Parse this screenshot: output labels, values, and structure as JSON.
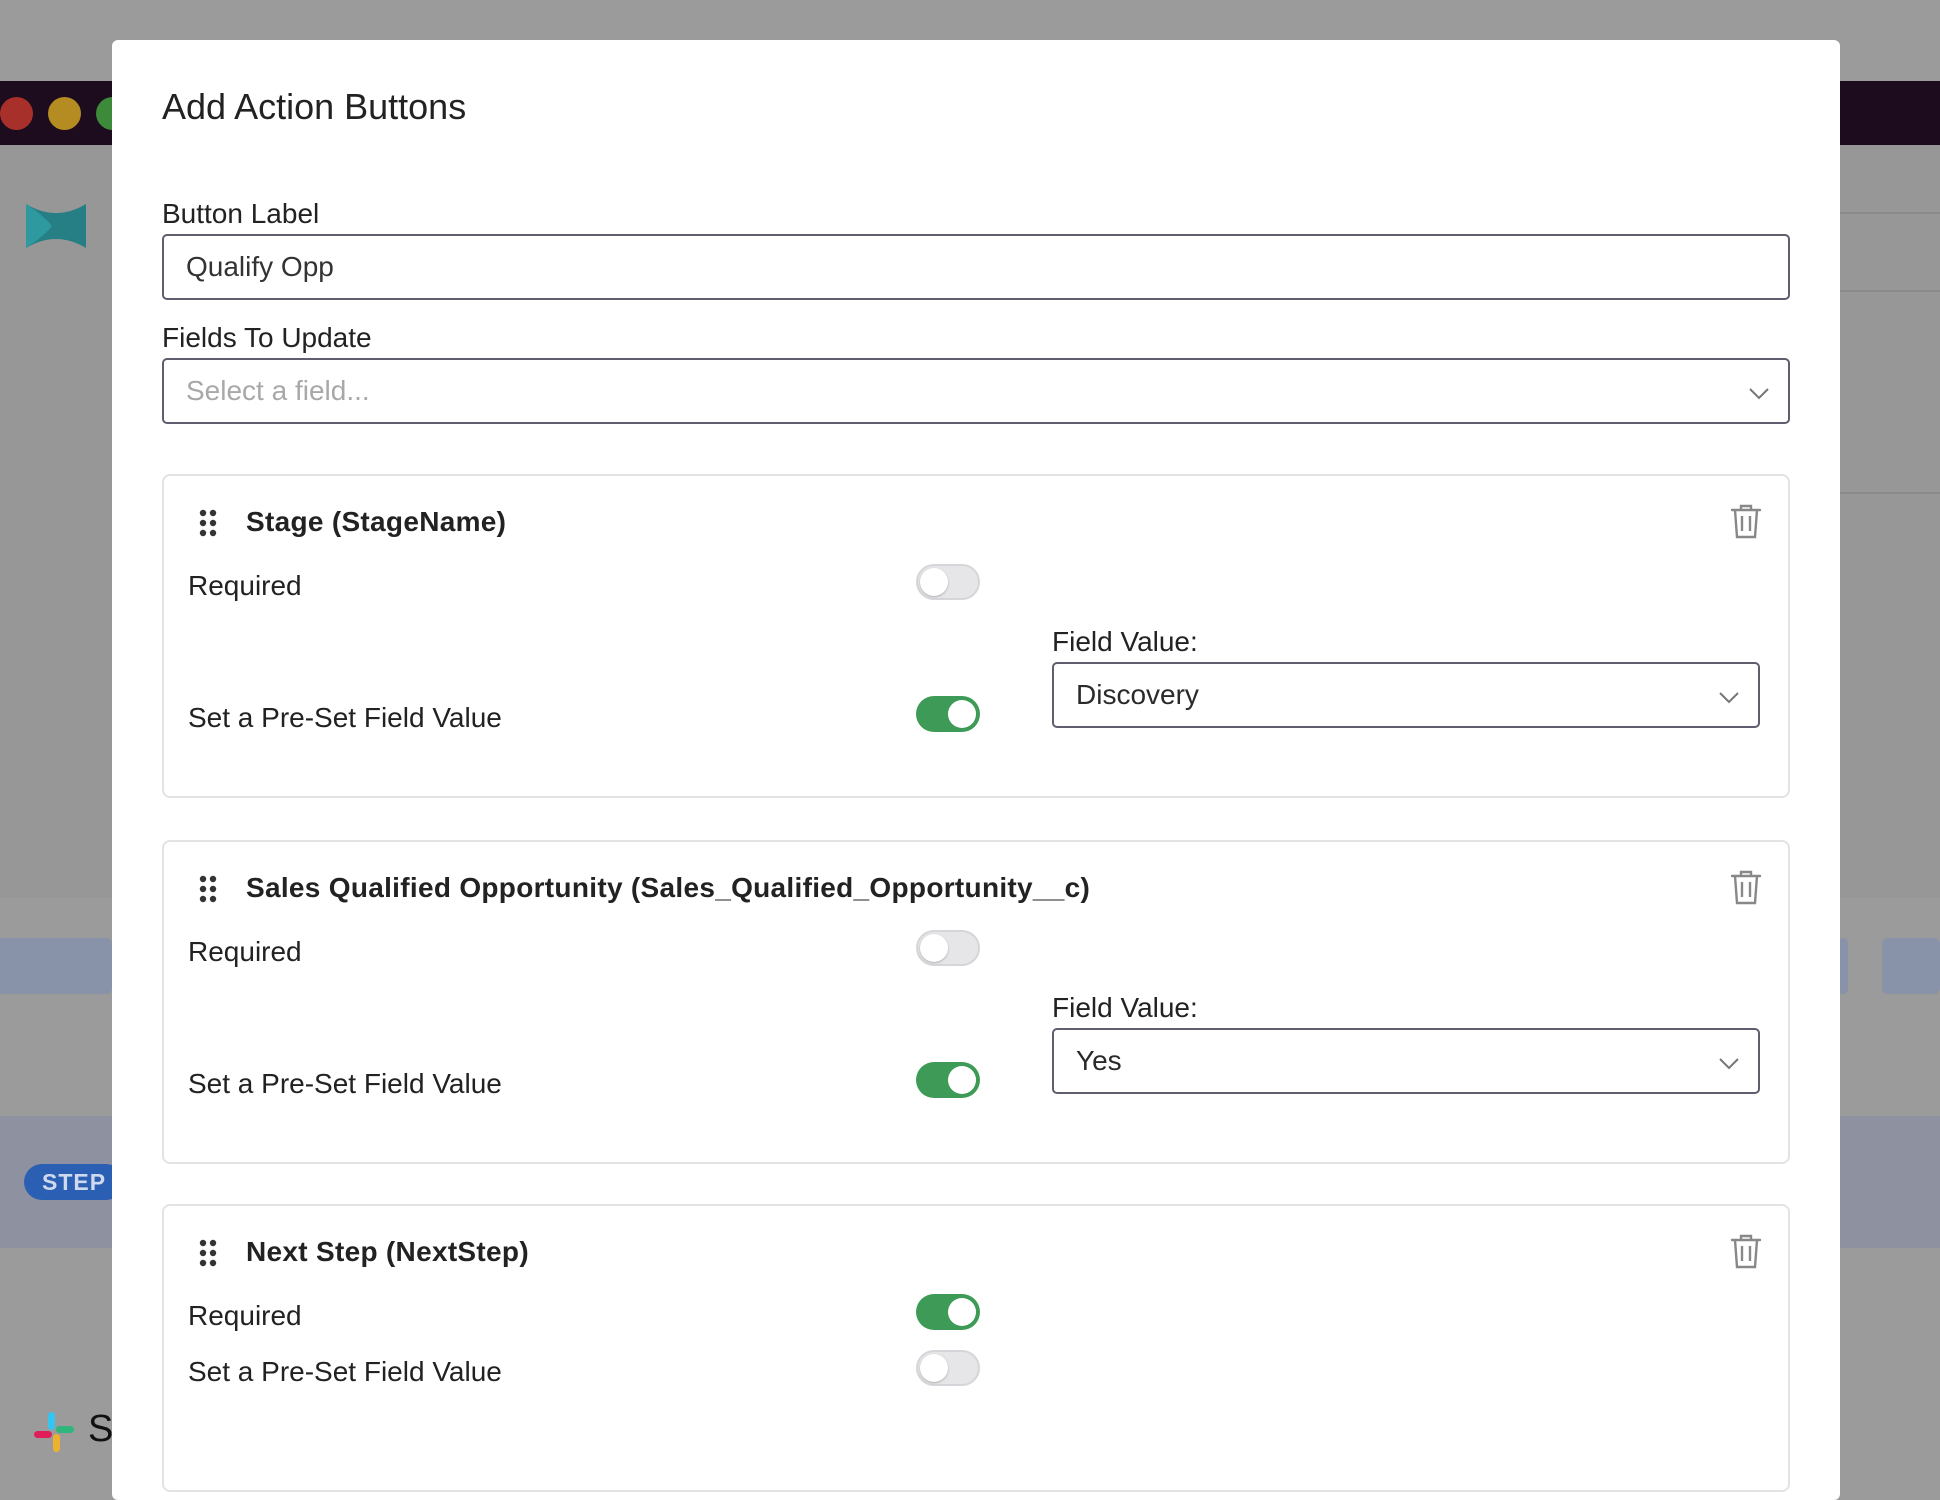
{
  "modal": {
    "title": "Add Action Buttons",
    "button_label": {
      "label": "Button Label",
      "value": "Qualify Opp"
    },
    "fields_to_update": {
      "label": "Fields To Update",
      "placeholder": "Select a field..."
    },
    "fields": [
      {
        "name": "Stage (StageName)",
        "required_label": "Required",
        "required": false,
        "preset_label": "Set a Pre-Set Field Value",
        "preset": true,
        "value_label": "Field Value:",
        "value": "Discovery"
      },
      {
        "name": "Sales Qualified Opportunity (Sales_Qualified_Opportunity__c)",
        "required_label": "Required",
        "required": false,
        "preset_label": "Set a Pre-Set Field Value",
        "preset": true,
        "value_label": "Field Value:",
        "value": "Yes"
      },
      {
        "name": "Next Step (NextStep)",
        "required_label": "Required",
        "required": true,
        "preset_label": "Set a Pre-Set Field Value",
        "preset": false
      }
    ]
  },
  "background": {
    "step_badge": "STEP",
    "app_text": "S"
  },
  "icons": {
    "drag": "drag-handle-icon",
    "delete": "trash-icon",
    "dropdown": "chevron-down-icon"
  },
  "colors": {
    "toggle_on": "#3d9a57",
    "toggle_off": "#e6e6e9",
    "step_badge": "#2b5fb3",
    "titlebar": "#1d0c1d"
  }
}
